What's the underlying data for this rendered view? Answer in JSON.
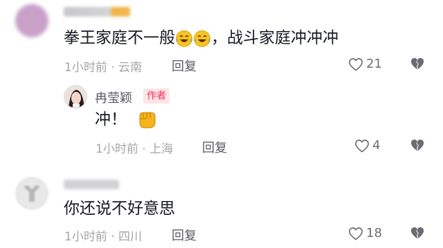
{
  "comments": [
    {
      "text_part1": "拳王家庭不一般",
      "text_part2": "，战斗家庭冲冲冲",
      "emojis": [
        "laughing-crying-emoji",
        "laughing-crying-emoji"
      ],
      "meta": "1小时前 · 云南",
      "reply_label": "回复",
      "likes": "21",
      "replies": [
        {
          "author": "冉莹颖",
          "badge": "作者",
          "text": "冲！",
          "emoji": "fist-bump-emoji",
          "meta": "1小时前 · 上海",
          "reply_label": "回复",
          "likes": "4"
        }
      ]
    },
    {
      "text": "你还说不好意思",
      "meta": "1小时前 · 四川",
      "reply_label": "回复",
      "likes": "18"
    }
  ],
  "colors": {
    "text": "#161823",
    "meta": "#a3a4a8",
    "badge_bg": "#fde4e7",
    "badge_text": "#fe2c55"
  }
}
